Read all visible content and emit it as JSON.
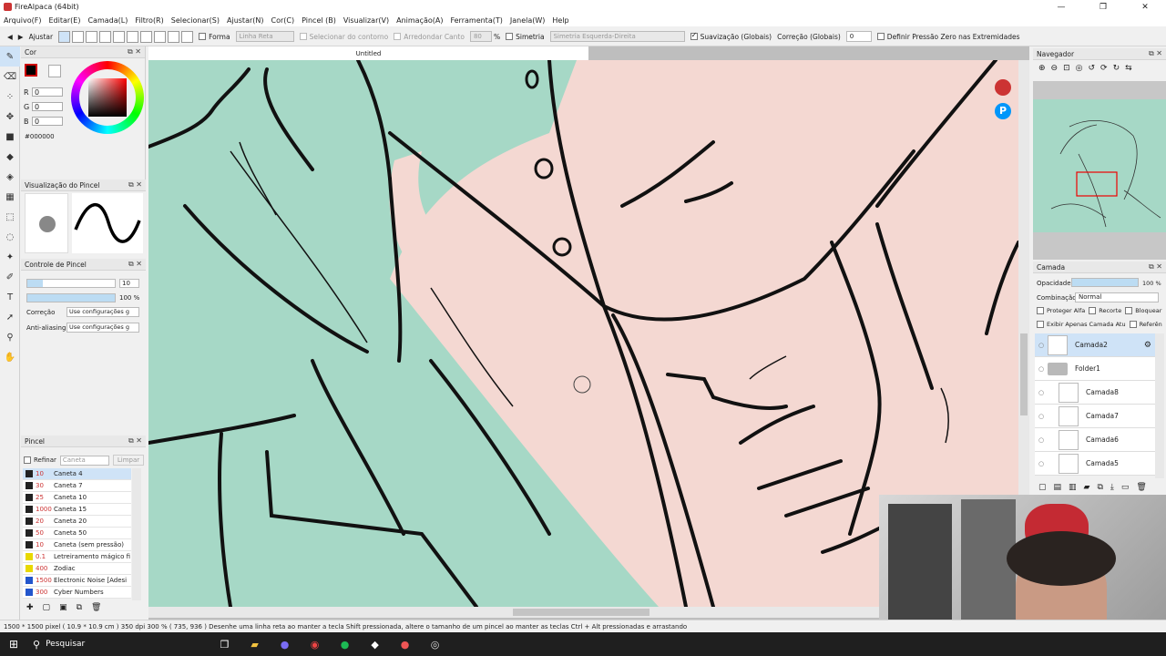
{
  "window": {
    "title": "FireAlpaca (64bit)"
  },
  "menu": [
    "Arquivo(F)",
    "Editar(E)",
    "Camada(L)",
    "Filtro(R)",
    "Selecionar(S)",
    "Ajustar(N)",
    "Cor(C)",
    "Pincel (B)",
    "Visualizar(V)",
    "Animação(A)",
    "Ferramenta(T)",
    "Janela(W)",
    "Help"
  ],
  "toolbar": {
    "ajustar": "Ajustar",
    "forma": "Forma",
    "forma_value": "Linha Reta",
    "selecionar_contorno": "Selecionar do contorno",
    "arredondar_canto": "Arredondar Canto",
    "arredondar_value": "80",
    "percent": "%",
    "simetria": "Simetria",
    "simetria_value": "Simetria Esquerda-Direita",
    "suavizacao": "Suavização (Globais)",
    "correcao": "Correção (Globais)",
    "correcao_value": "0",
    "pressao": "Definir Pressão Zero nas Extremidades"
  },
  "color_panel": {
    "title": "Cor",
    "r_label": "R",
    "g_label": "G",
    "b_label": "B",
    "r": "0",
    "g": "0",
    "b": "0",
    "hex": "#000000"
  },
  "brush_preview": {
    "title": "Visualização do Pincel"
  },
  "brush_control": {
    "title": "Controle de Pincel",
    "size": "10",
    "opacity": "100 %",
    "correcao_label": "Correção",
    "correcao_value": "Use configurações g",
    "aa_label": "Anti-aliasing",
    "aa_value": "Use configurações g"
  },
  "brush_panel": {
    "title": "Pincel",
    "refinar": "Refinar",
    "search_placeholder": "Caneta",
    "limpar": "Limpar",
    "brushes": [
      {
        "size": "10",
        "name": "Caneta 4",
        "color": "#222222"
      },
      {
        "size": "30",
        "name": "Caneta 7",
        "color": "#222222"
      },
      {
        "size": "25",
        "name": "Caneta 10",
        "color": "#222222"
      },
      {
        "size": "1000",
        "name": "Caneta 15",
        "color": "#222222"
      },
      {
        "size": "20",
        "name": "Caneta 20",
        "color": "#222222"
      },
      {
        "size": "50",
        "name": "Caneta 50",
        "color": "#222222"
      },
      {
        "size": "10",
        "name": "Caneta (sem pressão)",
        "color": "#222222"
      },
      {
        "size": "0.1",
        "name": "Letreiramento mágico fi",
        "color": "#e8d800"
      },
      {
        "size": "400",
        "name": "Zodiac",
        "color": "#e8d800"
      },
      {
        "size": "1500",
        "name": "Electronic Noise [Adesi",
        "color": "#2255cc"
      },
      {
        "size": "300",
        "name": "Cyber Numbers",
        "color": "#2255cc"
      }
    ]
  },
  "document": {
    "tab": "Untitled"
  },
  "navigator": {
    "title": "Navegador"
  },
  "layer_panel": {
    "title": "Camada",
    "opacity_label": "Opacidade",
    "opacity_value": "100 %",
    "blend_label": "Combinação",
    "blend_value": "Normal",
    "protect_alpha": "Proteger Alfa",
    "clipping": "Recorte",
    "lock": "Bloquear",
    "show_only": "Exibir Apenas Camada Atu",
    "reference": "Referên",
    "layers": [
      {
        "name": "Camada2",
        "type": "layer",
        "selected": true
      },
      {
        "name": "Folder1",
        "type": "folder",
        "selected": false
      },
      {
        "name": "Camada8",
        "type": "layer",
        "selected": false
      },
      {
        "name": "Camada7",
        "type": "layer",
        "selected": false
      },
      {
        "name": "Camada6",
        "type": "layer",
        "selected": false
      },
      {
        "name": "Camada5",
        "type": "layer",
        "selected": false
      }
    ]
  },
  "status": {
    "text": "1500 * 1500 pixel  ( 10.9 * 10.9 cm )  350 dpi  300 %  ( 735, 936 )  Desenhe uma linha reta ao manter a tecla Shift pressionada, altere o tamanho de um pincel ao manter as teclas Ctrl + Alt pressionadas e arrastando"
  },
  "taskbar": {
    "search": "Pesquisar"
  }
}
